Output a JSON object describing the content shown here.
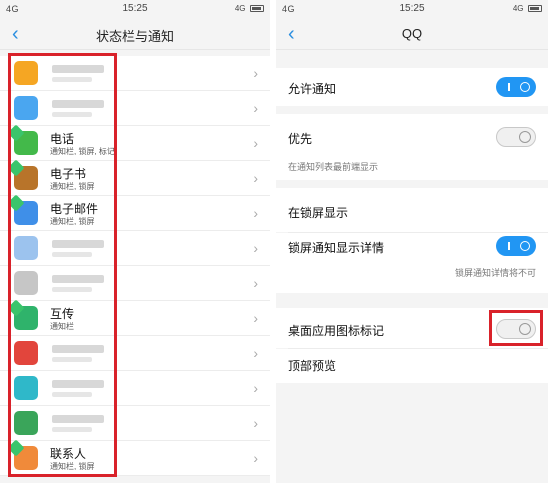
{
  "left": {
    "status": {
      "signal": "4G",
      "time": "15:25",
      "net": "4G"
    },
    "title": "状态栏与通知",
    "apps": [
      {
        "name": "",
        "sub": "",
        "icon": "app-icon-orange",
        "color": "#f5a623",
        "badge": false,
        "blurred": true
      },
      {
        "name": "",
        "sub": "",
        "icon": "app-icon-blue",
        "color": "#4aa6f0",
        "badge": false,
        "blurred": true
      },
      {
        "name": "电话",
        "sub": "通知栏, 锁屏, 标记",
        "icon": "phone-icon",
        "color": "#43b94a",
        "badge": true,
        "blurred": false
      },
      {
        "name": "电子书",
        "sub": "通知栏, 锁屏",
        "icon": "ebook-icon",
        "color": "#b8742a",
        "badge": true,
        "blurred": false
      },
      {
        "name": "电子邮件",
        "sub": "通知栏, 锁屏",
        "icon": "email-icon",
        "color": "#3f8fe8",
        "badge": true,
        "blurred": false
      },
      {
        "name": "",
        "sub": "",
        "icon": "map-icon",
        "color": "#9cc3ee",
        "badge": false,
        "blurred": true
      },
      {
        "name": "",
        "sub": "",
        "icon": "app-icon-grey",
        "color": "#c6c6c6",
        "badge": false,
        "blurred": true
      },
      {
        "name": "互传",
        "sub": "通知栏",
        "icon": "share-icon",
        "color": "#2fb36b",
        "badge": true,
        "blurred": false
      },
      {
        "name": "",
        "sub": "",
        "icon": "news-icon",
        "color": "#e2453c",
        "badge": false,
        "blurred": true
      },
      {
        "name": "",
        "sub": "",
        "icon": "app-icon-cyan",
        "color": "#2fb8c9",
        "badge": false,
        "blurred": true
      },
      {
        "name": "",
        "sub": "",
        "icon": "app-icon-green",
        "color": "#3aa55a",
        "badge": false,
        "blurred": true
      },
      {
        "name": "联系人",
        "sub": "通知栏, 锁屏",
        "icon": "contacts-icon",
        "color": "#f08a3a",
        "badge": true,
        "blurred": false
      }
    ]
  },
  "right": {
    "status": {
      "signal": "4G",
      "time": "15:25",
      "net": "4G"
    },
    "title": "QQ",
    "settings": {
      "allow_notify": "允许通知",
      "priority": "优先",
      "priority_note": "在通知列表最前端显示",
      "lockscreen_show": "在锁屏显示",
      "lockscreen_detail": "锁屏通知显示详情",
      "lockscreen_detail_note": "锁屏通知详情将不可",
      "desktop_badge": "桌面应用图标标记",
      "top_preview": "顶部预览"
    },
    "toggles": {
      "allow_notify": "on",
      "priority": "off",
      "lockscreen_detail": "on",
      "desktop_badge": "off"
    }
  },
  "colors": {
    "accent": "#2196f3",
    "highlight": "#d9222a"
  }
}
